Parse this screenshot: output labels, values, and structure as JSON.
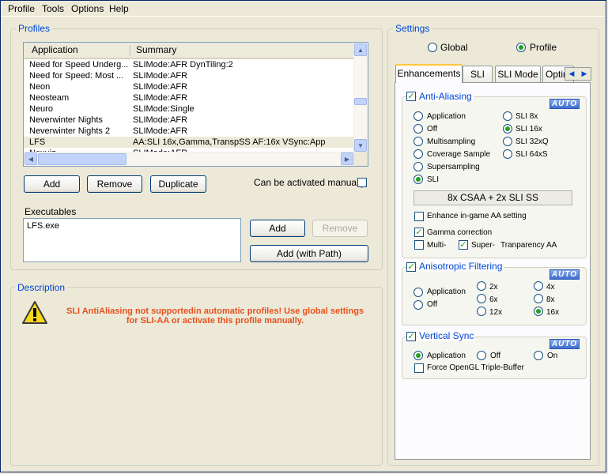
{
  "menu": [
    "Profile",
    "Tools",
    "Options",
    "Help"
  ],
  "profiles": {
    "group_title": "Profiles",
    "columns": [
      "Application",
      "Summary"
    ],
    "rows": [
      {
        "app": "Need for Speed Underg...",
        "summary": "SLIMode:AFR DynTiling:2"
      },
      {
        "app": "Need for Speed: Most ...",
        "summary": "SLIMode:AFR"
      },
      {
        "app": "Neon",
        "summary": "SLIMode:AFR"
      },
      {
        "app": "Neosteam",
        "summary": "SLIMode:AFR"
      },
      {
        "app": "Neuro",
        "summary": "SLIMode:Single"
      },
      {
        "app": "Neverwinter Nights",
        "summary": "SLIMode:AFR"
      },
      {
        "app": "Neverwinter Nights 2",
        "summary": "SLIMode:AFR"
      },
      {
        "app": "LFS",
        "summary": "AA:SLI 16x,Gamma,TranspSS AF:16x VSync:App"
      },
      {
        "app": "Nexuiz",
        "summary": "SLIMode:AFR"
      }
    ],
    "selected_row": "LFS",
    "add_label": "Add",
    "remove_label": "Remove",
    "duplicate_label": "Duplicate",
    "manual_label": "Can be activated manually",
    "manual_checked": false
  },
  "executables": {
    "title": "Executables",
    "items": [
      "LFS.exe"
    ],
    "add_label": "Add",
    "remove_label": "Remove",
    "add_path_label": "Add (with Path)"
  },
  "description": {
    "title": "Description",
    "message_line1": "SLI AntiAliasing not supportedin automatic profiles! Use global settings",
    "message_line2": "for SLI-AA or activate this profile manually.",
    "message_color": "#e8501e"
  },
  "settings": {
    "title": "Settings",
    "global_label": "Global",
    "profile_label": "Profile",
    "scope_selected": "Profile",
    "tabs": [
      "Enhancements",
      "SLI",
      "SLI Mode",
      "Optin"
    ],
    "active_tab": "Enhancements",
    "auto_label": "AUTO",
    "anti_aliasing": {
      "title": "Anti-Aliasing",
      "enabled": true,
      "modes": [
        "Application",
        "Off",
        "Multisampling",
        "Coverage Sample",
        "Supersampling",
        "SLI"
      ],
      "selected_mode": "SLI",
      "sli_levels": [
        "SLI 8x",
        "SLI 16x",
        "SLI 32xQ",
        "SLI 64xS"
      ],
      "selected_level": "SLI 16x",
      "summary": "8x CSAA + 2x SLI SS",
      "enhance_label": "Enhance in-game AA setting",
      "enhance_checked": false,
      "gamma_label": "Gamma correction",
      "gamma_checked": true,
      "multi_label": "Multi-",
      "multi_checked": false,
      "super_label": "Super-",
      "super_checked": true,
      "transparency_label": "Tranparency AA"
    },
    "anisotropic": {
      "title": "Anisotropic Filtering",
      "enabled": true,
      "modes": [
        "Application",
        "Off"
      ],
      "levels": [
        "2x",
        "4x",
        "6x",
        "8x",
        "12x",
        "16x"
      ],
      "selected_level": "16x"
    },
    "vsync": {
      "title": "Vertical Sync",
      "enabled": true,
      "options": [
        "Application",
        "Off",
        "On"
      ],
      "selected": "Application",
      "triple_buffer_label": "Force OpenGL Triple-Buffer",
      "triple_buffer_checked": false
    }
  },
  "colors": {
    "group_title": "#0046d5",
    "window_bg": "#ece9d8",
    "check_green": "#21a121"
  }
}
